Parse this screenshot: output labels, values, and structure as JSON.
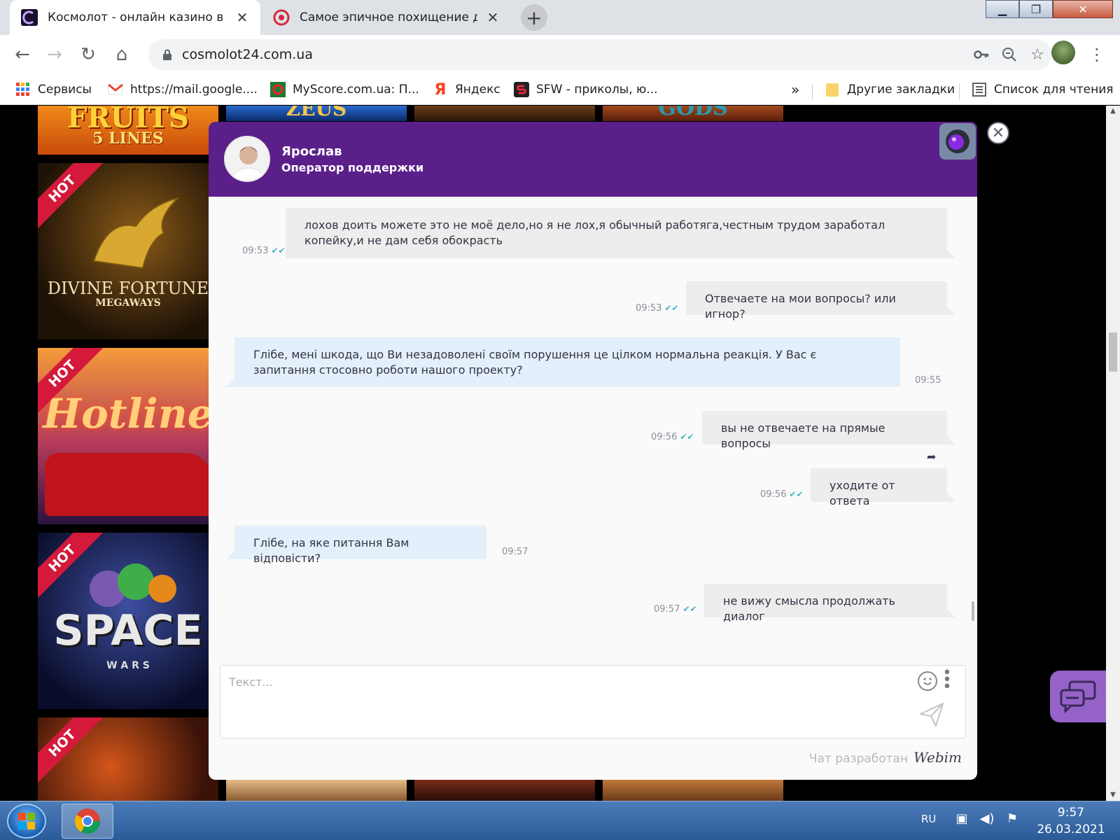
{
  "browser": {
    "tabs": [
      {
        "title": "Космолот - онлайн казино в Укр",
        "active": true
      },
      {
        "title": "Самое эпичное похищение ден",
        "active": false
      }
    ],
    "url": "cosmolot24.com.ua",
    "bookmarks": [
      {
        "label": "Сервисы"
      },
      {
        "label": "https://mail.google...."
      },
      {
        "label": "MyScore.com.ua: П..."
      },
      {
        "label": "Яндекс"
      },
      {
        "label": "SFW - приколы, ю..."
      }
    ],
    "overflow": "»",
    "other_bookmarks": "Другие закладки",
    "reading_list": "Список для чтения"
  },
  "games": {
    "hot_label": "HOT",
    "tiles": [
      {
        "name": "FRUITS",
        "sub": "5 LINES"
      },
      {
        "name": "DIVINE FORTUNE",
        "sub": "MEGAWAYS"
      },
      {
        "name": "Hotline",
        "sub": ""
      },
      {
        "name": "SPACE",
        "sub": "W A R S"
      },
      {
        "name": "",
        "sub": ""
      },
      {
        "name": "ZEUS",
        "sub": ""
      },
      {
        "name": "GODS",
        "sub": ""
      }
    ]
  },
  "chat": {
    "operator_name": "Ярослав",
    "operator_role": "Оператор поддержки",
    "messages": [
      {
        "dir": "out",
        "text": "лохов доить можете это не моё дело,но я не лох,я обычный работяга,честным трудом заработал копейку,и не дам себя обокрасть",
        "time": "09:53"
      },
      {
        "dir": "out",
        "text": "Отвечаете на мои вопросы? или игнор?",
        "time": "09:53"
      },
      {
        "dir": "in",
        "text": "Глібе, мені шкода, що Ви незадоволені своїм порушення це цілком нормальна реакція. У Вас є запитання стосовно роботи нашого проекту?",
        "time": "09:55"
      },
      {
        "dir": "out",
        "text": "вы не отвечаете на прямые вопросы",
        "time": "09:56"
      },
      {
        "dir": "out",
        "text": "уходите от ответа",
        "time": "09:56"
      },
      {
        "dir": "in",
        "text": "Глібе, на яке питання Вам відповісти?",
        "time": "09:57"
      },
      {
        "dir": "out",
        "text": "не вижу смысла продолжать диалог",
        "time": "09:57"
      }
    ],
    "input_placeholder": "Текст...",
    "powered_by": "Чат разработан",
    "brand": "Webim"
  },
  "taskbar": {
    "lang": "RU",
    "time": "9:57",
    "date": "26.03.2021"
  }
}
